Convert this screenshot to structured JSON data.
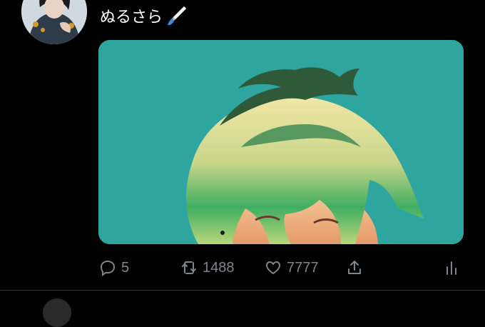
{
  "tweet": {
    "author_name": "ぬるさら",
    "emoji_icon": "paintbrush-icon"
  },
  "actions": {
    "reply": {
      "icon": "reply-icon",
      "count": "5"
    },
    "retweet": {
      "icon": "retweet-icon",
      "count": "1488"
    },
    "like": {
      "icon": "heart-icon",
      "count": "7777"
    },
    "share": {
      "icon": "share-icon"
    },
    "analytics": {
      "icon": "analytics-icon"
    }
  },
  "colors": {
    "background": "#000000",
    "text": "#ffffff",
    "action_gray": "#7f8589",
    "media_teal": "#2fa5a0"
  }
}
